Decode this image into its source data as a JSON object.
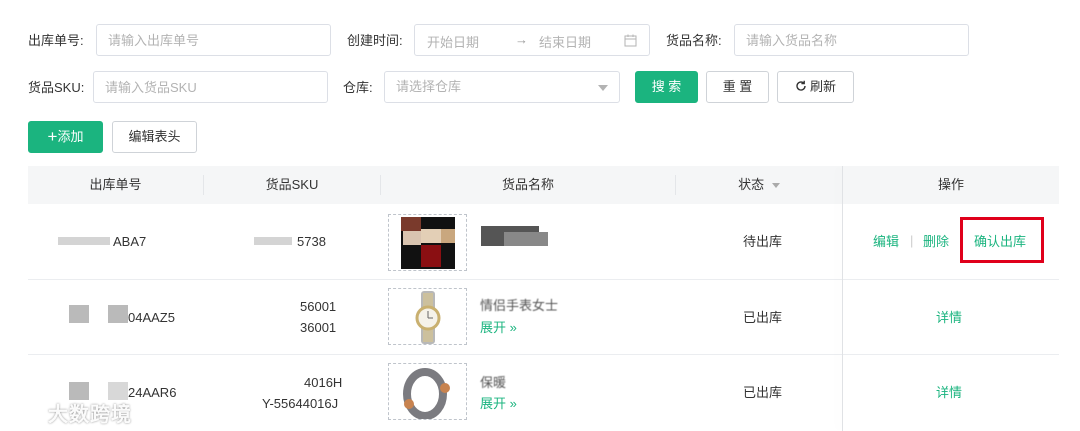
{
  "filters": {
    "out_no_label": "出库单号:",
    "out_no_placeholder": "请输入出库单号",
    "created_label": "创建时间:",
    "start_date": "开始日期",
    "arrow": "→",
    "end_date": "结束日期",
    "goods_name_label": "货品名称:",
    "goods_name_placeholder": "请输入货品名称",
    "sku_label": "货品SKU:",
    "sku_placeholder": "请输入货品SKU",
    "warehouse_label": "仓库:",
    "warehouse_placeholder": "请选择仓库",
    "search_btn": "搜 索",
    "reset_btn": "重 置",
    "refresh_btn": "刷新"
  },
  "toolbar": {
    "add_btn": "添加",
    "edit_header_btn": "编辑表头"
  },
  "table": {
    "headers": {
      "out_no": "出库单号",
      "sku": "货品SKU",
      "name": "货品名称",
      "status": "状态",
      "ops": "操作"
    },
    "rows": [
      {
        "out_no": "ABA7",
        "sku": "5738",
        "status": "待出库",
        "ops": {
          "edit": "编辑",
          "sep": "|",
          "delete": "删除",
          "confirm": "确认出库"
        }
      },
      {
        "out_no": "04AAZ5",
        "sku_line1": "56001",
        "sku_line2": "36001",
        "name": "情侣手表女士",
        "expand": "展开 »",
        "status": "已出库",
        "ops": {
          "detail": "详情"
        }
      },
      {
        "out_no": "24AAR6",
        "sku_line1": "4016H",
        "sku_line2": "Y-55644016J",
        "name": "保暖",
        "expand": "展开 »",
        "status": "已出库",
        "ops": {
          "detail": "详情"
        }
      }
    ]
  },
  "watermark": "大数跨境",
  "colors": {
    "accent": "#1bb47f",
    "highlight_border": "#e0001b"
  }
}
